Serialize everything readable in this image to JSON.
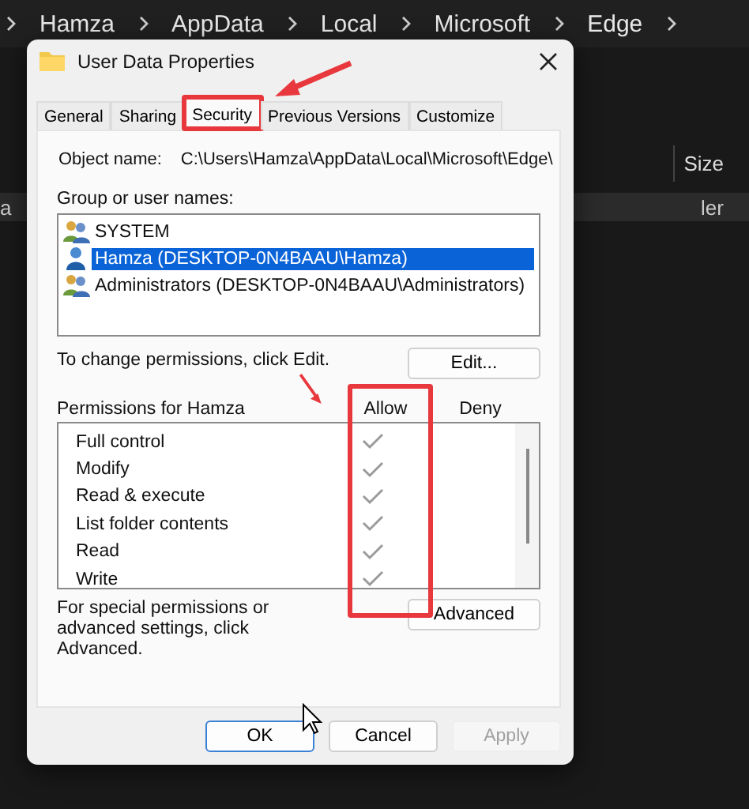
{
  "explorer": {
    "breadcrumb": [
      "Hamza",
      "AppData",
      "Local",
      "Microsoft",
      "Edge"
    ],
    "column_header": "Size",
    "row_cells": [
      "a",
      "ler"
    ]
  },
  "dialog": {
    "title": "User Data Properties",
    "tabs": [
      {
        "label": "General",
        "selected": false
      },
      {
        "label": "Sharing",
        "selected": false
      },
      {
        "label": "Security",
        "selected": true
      },
      {
        "label": "Previous Versions",
        "selected": false
      },
      {
        "label": "Customize",
        "selected": false
      }
    ],
    "object_name_label": "Object name:",
    "object_name": "C:\\Users\\Hamza\\AppData\\Local\\Microsoft\\Edge\\",
    "groups_label": "Group or user names:",
    "groups": [
      {
        "name": "SYSTEM",
        "kind": "group",
        "selected": false
      },
      {
        "name": "Hamza (DESKTOP-0N4BAAU\\Hamza)",
        "kind": "user",
        "selected": true
      },
      {
        "name": "Administrators (DESKTOP-0N4BAAU\\Administrators)",
        "kind": "group",
        "selected": false
      }
    ],
    "change_hint": "To change permissions, click Edit.",
    "edit_button": "Edit...",
    "permissions_label": "Permissions for Hamza",
    "allow_header": "Allow",
    "deny_header": "Deny",
    "permissions": [
      {
        "name": "Full control",
        "allow": true,
        "deny": false
      },
      {
        "name": "Modify",
        "allow": true,
        "deny": false
      },
      {
        "name": "Read & execute",
        "allow": true,
        "deny": false
      },
      {
        "name": "List folder contents",
        "allow": true,
        "deny": false
      },
      {
        "name": "Read",
        "allow": true,
        "deny": false
      },
      {
        "name": "Write",
        "allow": true,
        "deny": false
      }
    ],
    "advanced_hint": "For special permissions or advanced settings, click Advanced.",
    "advanced_button": "Advanced",
    "buttons": [
      {
        "label": "OK",
        "kind": "default"
      },
      {
        "label": "Cancel",
        "kind": "normal"
      },
      {
        "label": "Apply",
        "kind": "disabled"
      }
    ]
  }
}
